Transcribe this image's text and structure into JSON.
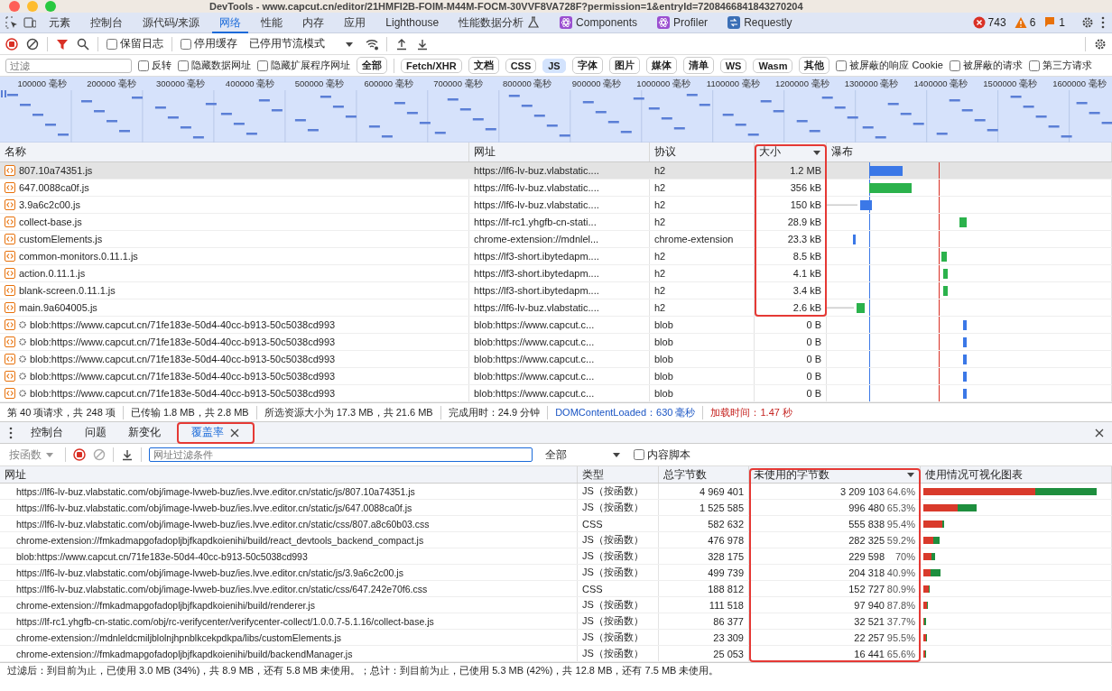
{
  "window": {
    "title": "DevTools - www.capcut.cn/editor/21HMFI2B-FOIM-M44M-FOCM-30VVF8VA728F?permission=1&entryId=7208466841843270204"
  },
  "panel_tabs": [
    {
      "label": "元素",
      "kind": "plain",
      "selected": false
    },
    {
      "label": "控制台",
      "kind": "plain",
      "selected": false
    },
    {
      "label": "源代码/来源",
      "kind": "plain",
      "selected": false
    },
    {
      "label": "网络",
      "kind": "plain",
      "selected": true
    },
    {
      "label": "性能",
      "kind": "plain",
      "selected": false
    },
    {
      "label": "内存",
      "kind": "plain",
      "selected": false
    },
    {
      "label": "应用",
      "kind": "plain",
      "selected": false
    },
    {
      "label": "Lighthouse",
      "kind": "plain",
      "selected": false
    },
    {
      "label": "性能数据分析",
      "kind": "experimental",
      "selected": false
    },
    {
      "label": "Components",
      "kind": "react",
      "selected": false
    },
    {
      "label": "Profiler",
      "kind": "react",
      "selected": false
    },
    {
      "label": "Requestly",
      "kind": "requestly",
      "selected": false
    }
  ],
  "issues": {
    "errors": "743",
    "warnings": "6",
    "info": "1"
  },
  "network_toolbar": {
    "recording": true,
    "checks": [
      {
        "label": "保留日志",
        "checked": false
      },
      {
        "label": "停用缓存",
        "checked": false
      }
    ],
    "throttling": "已停用节流模式"
  },
  "filter_bar": {
    "placeholder": "过滤",
    "checks": [
      {
        "label": "反转",
        "checked": false
      },
      {
        "label": "隐藏数据网址",
        "checked": false
      },
      {
        "label": "隐藏扩展程序网址",
        "checked": false
      }
    ],
    "types": [
      {
        "label": "全部",
        "selected": false
      },
      {
        "label": "Fetch/XHR",
        "selected": false
      },
      {
        "label": "文档",
        "selected": false
      },
      {
        "label": "CSS",
        "selected": false
      },
      {
        "label": "JS",
        "selected": true
      },
      {
        "label": "字体",
        "selected": false
      },
      {
        "label": "图片",
        "selected": false
      },
      {
        "label": "媒体",
        "selected": false
      },
      {
        "label": "清单",
        "selected": false
      },
      {
        "label": "WS",
        "selected": false
      },
      {
        "label": "Wasm",
        "selected": false
      },
      {
        "label": "其他",
        "selected": false
      }
    ],
    "more_checks": [
      {
        "label": "被屏蔽的响应 Cookie",
        "checked": false
      },
      {
        "label": "被屏蔽的请求",
        "checked": false
      },
      {
        "label": "第三方请求",
        "checked": false
      }
    ]
  },
  "overview": {
    "ticks": [
      "100000 毫秒",
      "200000 毫秒",
      "300000 毫秒",
      "400000 毫秒",
      "500000 毫秒",
      "600000 毫秒",
      "700000 毫秒",
      "800000 毫秒",
      "900000 毫秒",
      "1000000 毫秒",
      "1100000 毫秒",
      "1200000 毫秒",
      "1300000 毫秒",
      "1400000 毫秒",
      "1500000 毫秒",
      "1600000 毫秒"
    ]
  },
  "requests": {
    "columns": [
      {
        "label": "名称",
        "sorted": false,
        "annotated": false
      },
      {
        "label": "网址",
        "sorted": false,
        "annotated": false
      },
      {
        "label": "协议",
        "sorted": false,
        "annotated": false
      },
      {
        "label": "大小",
        "sorted": true,
        "annotated": true
      },
      {
        "label": "瀑布",
        "sorted": false,
        "annotated": false
      }
    ],
    "rows": [
      {
        "kind": "script",
        "name": "807.10a74351.js",
        "url": "https://lf6-lv-buz.vlabstatic....",
        "protocol": "h2",
        "size": "1.2 MB",
        "selected": true,
        "annotated": true
      },
      {
        "kind": "script",
        "name": "647.0088ca0f.js",
        "url": "https://lf6-lv-buz.vlabstatic....",
        "protocol": "h2",
        "size": "356 kB",
        "selected": false,
        "annotated": true
      },
      {
        "kind": "script",
        "name": "3.9a6c2c00.js",
        "url": "https://lf6-lv-buz.vlabstatic....",
        "protocol": "h2",
        "size": "150 kB",
        "selected": false,
        "annotated": true
      },
      {
        "kind": "script",
        "name": "collect-base.js",
        "url": "https://lf-rc1.yhgfb-cn-stati...",
        "protocol": "h2",
        "size": "28.9 kB",
        "selected": false,
        "annotated": true
      },
      {
        "kind": "script",
        "name": "customElements.js",
        "url": "chrome-extension://mdnlel...",
        "protocol": "chrome-extension",
        "size": "23.3 kB",
        "selected": false,
        "annotated": true
      },
      {
        "kind": "script",
        "name": "common-monitors.0.11.1.js",
        "url": "https://lf3-short.ibytedapm....",
        "protocol": "h2",
        "size": "8.5 kB",
        "selected": false,
        "annotated": true
      },
      {
        "kind": "script",
        "name": "action.0.11.1.js",
        "url": "https://lf3-short.ibytedapm....",
        "protocol": "h2",
        "size": "4.1 kB",
        "selected": false,
        "annotated": true
      },
      {
        "kind": "script",
        "name": "blank-screen.0.11.1.js",
        "url": "https://lf3-short.ibytedapm....",
        "protocol": "h2",
        "size": "3.4 kB",
        "selected": false,
        "annotated": true
      },
      {
        "kind": "script",
        "name": "main.9a604005.js",
        "url": "https://lf6-lv-buz.vlabstatic....",
        "protocol": "h2",
        "size": "2.6 kB",
        "selected": false,
        "annotated": true
      },
      {
        "kind": "blob",
        "name": "blob:https://www.capcut.cn/71fe183e-50d4-40cc-b913-50c5038cd993",
        "url": "blob:https://www.capcut.c...",
        "protocol": "blob",
        "size": "0 B",
        "selected": false,
        "annotated": false
      },
      {
        "kind": "blob",
        "name": "blob:https://www.capcut.cn/71fe183e-50d4-40cc-b913-50c5038cd993",
        "url": "blob:https://www.capcut.c...",
        "protocol": "blob",
        "size": "0 B",
        "selected": false,
        "annotated": false
      },
      {
        "kind": "blob",
        "name": "blob:https://www.capcut.cn/71fe183e-50d4-40cc-b913-50c5038cd993",
        "url": "blob:https://www.capcut.c...",
        "protocol": "blob",
        "size": "0 B",
        "selected": false,
        "annotated": false
      },
      {
        "kind": "blob",
        "name": "blob:https://www.capcut.cn/71fe183e-50d4-40cc-b913-50c5038cd993",
        "url": "blob:https://www.capcut.c...",
        "protocol": "blob",
        "size": "0 B",
        "selected": false,
        "annotated": false
      },
      {
        "kind": "blob",
        "name": "blob:https://www.capcut.cn/71fe183e-50d4-40cc-b913-50c5038cd993",
        "url": "blob:https://www.capcut.c...",
        "protocol": "blob",
        "size": "0 B",
        "selected": false,
        "annotated": false
      }
    ]
  },
  "status_bar": [
    {
      "kind": "plain",
      "text": "第 40 项请求，共 248 项"
    },
    {
      "kind": "plain",
      "text": "已传输 1.8 MB，共 2.8 MB"
    },
    {
      "kind": "plain",
      "text": "所选资源大小为 17.3 MB，共 21.6 MB"
    },
    {
      "kind": "plain",
      "text": "完成用时：24.9 分钟"
    },
    {
      "kind": "dcl",
      "text": "DOMContentLoaded：630 毫秒"
    },
    {
      "kind": "load",
      "text": "加载时间：1.47 秒"
    }
  ],
  "drawer": {
    "tabs": [
      {
        "label": "控制台",
        "selected": false,
        "closable": false,
        "annotated": false
      },
      {
        "label": "问题",
        "selected": false,
        "closable": false,
        "annotated": false
      },
      {
        "label": "新变化",
        "selected": false,
        "closable": false,
        "annotated": false
      },
      {
        "label": "覆盖率",
        "selected": true,
        "closable": true,
        "annotated": true
      }
    ]
  },
  "coverage": {
    "instrumentation": "按函数",
    "url_filter_placeholder": "网址过滤条件",
    "type_filter": "全部",
    "content_scripts": {
      "label": "内容脚本",
      "checked": false
    },
    "columns": [
      {
        "label": "网址",
        "sorted": false,
        "annotated": false
      },
      {
        "label": "类型",
        "sorted": false,
        "annotated": false
      },
      {
        "label": "总字节数",
        "sorted": false,
        "annotated": false
      },
      {
        "label": "未使用的字节数",
        "sorted": true,
        "annotated": true
      },
      {
        "label": "使用情况可视化图表",
        "sorted": false,
        "annotated": false
      }
    ],
    "rows": [
      {
        "url": "https://lf6-lv-buz.vlabstatic.com/obj/image-lvweb-buz/ies.lvve.editor.cn/static/js/807.10a74351.js",
        "type": "JS（按函数）",
        "total": "4 969 401",
        "unused": "3 209 103",
        "unused_percent": "64.6%"
      },
      {
        "url": "https://lf6-lv-buz.vlabstatic.com/obj/image-lvweb-buz/ies.lvve.editor.cn/static/js/647.0088ca0f.js",
        "type": "JS（按函数）",
        "total": "1 525 585",
        "unused": "996 480",
        "unused_percent": "65.3%"
      },
      {
        "url": "https://lf6-lv-buz.vlabstatic.com/obj/image-lvweb-buz/ies.lvve.editor.cn/static/css/807.a8c60b03.css",
        "type": "CSS",
        "total": "582 632",
        "unused": "555 838",
        "unused_percent": "95.4%"
      },
      {
        "url": "chrome-extension://fmkadmapgofadopljbjfkapdkoienihi/build/react_devtools_backend_compact.js",
        "type": "JS（按函数）",
        "total": "476 978",
        "unused": "282 325",
        "unused_percent": "59.2%"
      },
      {
        "url": "blob:https://www.capcut.cn/71fe183e-50d4-40cc-b913-50c5038cd993",
        "type": "JS（按函数）",
        "total": "328 175",
        "unused": "229 598",
        "unused_percent": "70%"
      },
      {
        "url": "https://lf6-lv-buz.vlabstatic.com/obj/image-lvweb-buz/ies.lvve.editor.cn/static/js/3.9a6c2c00.js",
        "type": "JS（按函数）",
        "total": "499 739",
        "unused": "204 318",
        "unused_percent": "40.9%"
      },
      {
        "url": "https://lf6-lv-buz.vlabstatic.com/obj/image-lvweb-buz/ies.lvve.editor.cn/static/css/647.242e70f6.css",
        "type": "CSS",
        "total": "188 812",
        "unused": "152 727",
        "unused_percent": "80.9%"
      },
      {
        "url": "chrome-extension://fmkadmapgofadopljbjfkapdkoienihi/build/renderer.js",
        "type": "JS（按函数）",
        "total": "111 518",
        "unused": "97 940",
        "unused_percent": "87.8%"
      },
      {
        "url": "https://lf-rc1.yhgfb-cn-static.com/obj/rc-verifycenter/verifycenter-collect/1.0.0.7-5.1.16/collect-base.js",
        "type": "JS（按函数）",
        "total": "86 377",
        "unused": "32 521",
        "unused_percent": "37.7%"
      },
      {
        "url": "chrome-extension://mdnleldcmiljblolnjhpnblkcekpdkpa/libs/customElements.js",
        "type": "JS（按函数）",
        "total": "23 309",
        "unused": "22 257",
        "unused_percent": "95.5%"
      },
      {
        "url": "chrome-extension://fmkadmapgofadopljbjfkapdkoienihi/build/backendManager.js",
        "type": "JS（按函数）",
        "total": "25 053",
        "unused": "16 441",
        "unused_percent": "65.6%"
      }
    ],
    "summary": "过滤后：到目前为止，已使用 3.0 MB (34%)，共 8.9 MB，还有 5.8 MB 未使用。；总计：到目前为止，已使用 5.3 MB (42%)，共 12.8 MB，还有 7.5 MB 未使用。"
  }
}
